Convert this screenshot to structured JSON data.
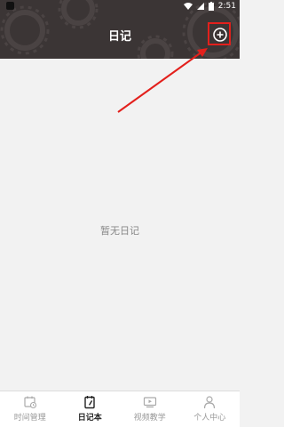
{
  "status_bar": {
    "time": "2:51"
  },
  "header": {
    "title": "日记",
    "add_icon": "plus-circle-icon"
  },
  "main": {
    "empty_text": "暂无日记"
  },
  "tabs": [
    {
      "label": "时间管理",
      "icon": "calendar-clock-icon",
      "active": false
    },
    {
      "label": "日记本",
      "icon": "notebook-pen-icon",
      "active": true
    },
    {
      "label": "视频教学",
      "icon": "video-screen-icon",
      "active": false
    },
    {
      "label": "个人中心",
      "icon": "person-icon",
      "active": false
    }
  ],
  "colors": {
    "header_bg": "#3b3535",
    "annotation_red": "#e3201c",
    "active_tab": "#222222",
    "inactive_tab": "#999999"
  }
}
